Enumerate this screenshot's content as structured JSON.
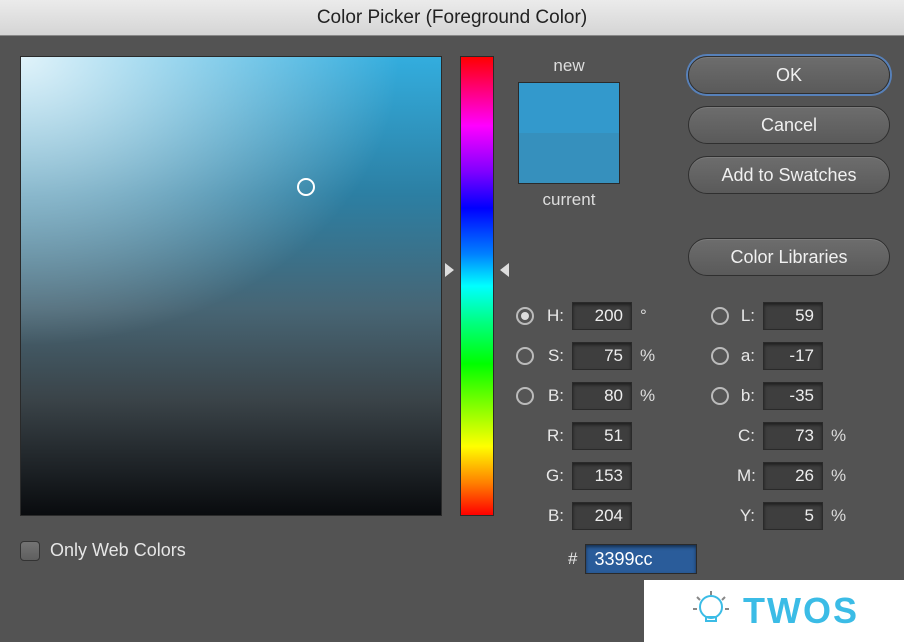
{
  "window": {
    "title": "Color Picker (Foreground Color)"
  },
  "buttons": {
    "ok": "OK",
    "cancel": "Cancel",
    "add_swatches": "Add to Swatches",
    "color_libraries": "Color Libraries"
  },
  "swatch": {
    "new_label": "new",
    "current_label": "current",
    "new_color": "#3399cc",
    "current_color": "#3690bd"
  },
  "only_web": {
    "label": "Only Web Colors",
    "checked": false
  },
  "color_model": {
    "selected": "H"
  },
  "values": {
    "H": {
      "label": "H:",
      "value": "200",
      "unit": "°"
    },
    "S": {
      "label": "S:",
      "value": "75",
      "unit": "%"
    },
    "Bv": {
      "label": "B:",
      "value": "80",
      "unit": "%"
    },
    "R": {
      "label": "R:",
      "value": "51"
    },
    "G": {
      "label": "G:",
      "value": "153"
    },
    "B": {
      "label": "B:",
      "value": "204"
    },
    "L": {
      "label": "L:",
      "value": "59"
    },
    "a": {
      "label": "a:",
      "value": "-17"
    },
    "b": {
      "label": "b:",
      "value": "-35"
    },
    "C": {
      "label": "C:",
      "value": "73",
      "unit": "%"
    },
    "M": {
      "label": "M:",
      "value": "26",
      "unit": "%"
    },
    "Y": {
      "label": "Y:",
      "value": "5",
      "unit": "%"
    }
  },
  "hex": {
    "label": "#",
    "value": "3399cc"
  },
  "watermark": {
    "text": "TWOS"
  }
}
